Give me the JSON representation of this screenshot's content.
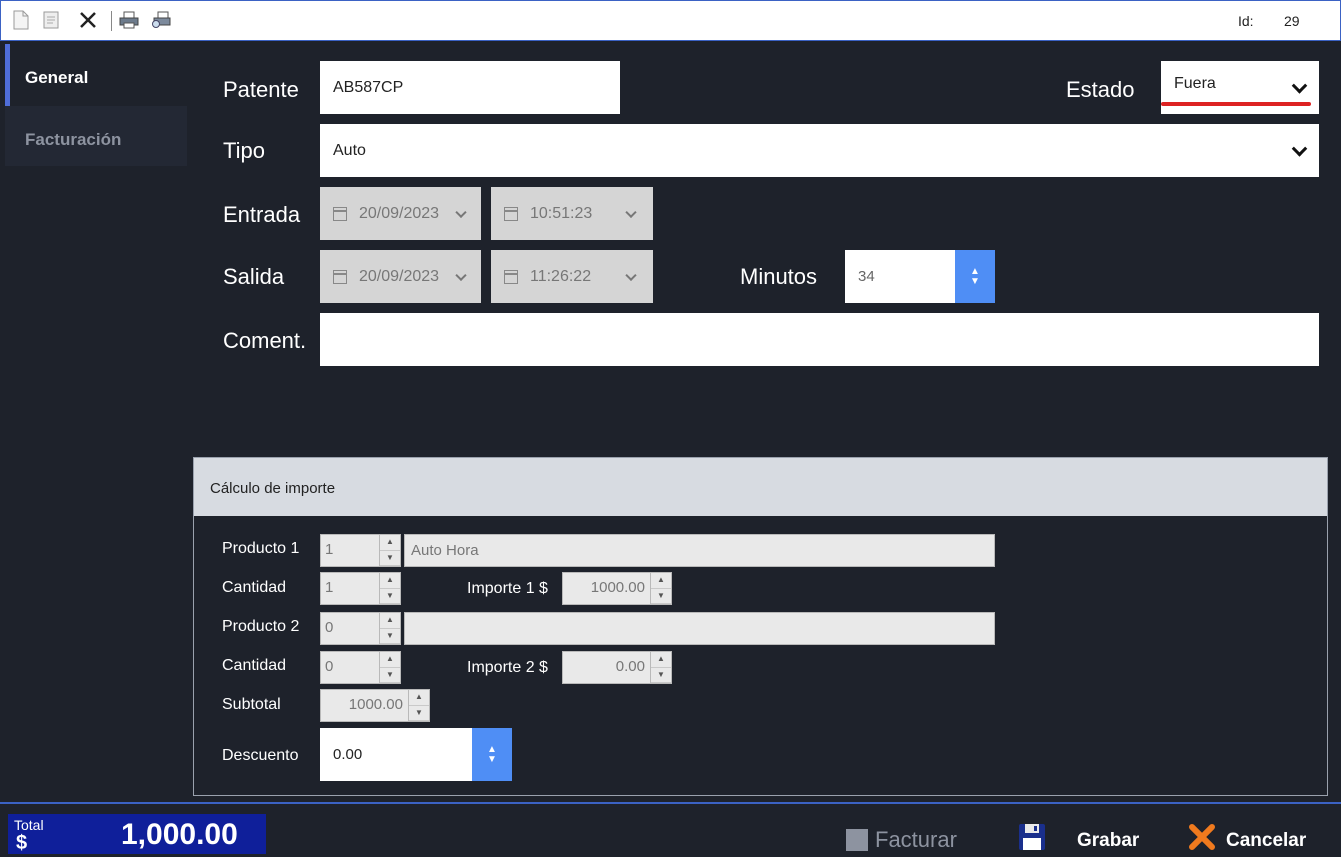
{
  "toolbar": {
    "id_label": "Id:",
    "id_value": "29",
    "icons": [
      "new-document-icon",
      "edit-document-icon",
      "delete-icon",
      "print-icon",
      "print-preview-icon"
    ]
  },
  "tabs": {
    "general": "General",
    "facturacion": "Facturación"
  },
  "form": {
    "patente_label": "Patente",
    "patente_value": "AB587CP",
    "estado_label": "Estado",
    "estado_value": "Fuera",
    "tipo_label": "Tipo",
    "tipo_value": "Auto",
    "entrada_label": "Entrada",
    "entrada_date": "20/09/2023",
    "entrada_time": "10:51:23",
    "salida_label": "Salida",
    "salida_date": "20/09/2023",
    "salida_time": "11:26:22",
    "minutos_label": "Minutos",
    "minutos_value": "34",
    "coment_label": "Coment.",
    "coment_value": ""
  },
  "calc": {
    "title": "Cálculo de importe",
    "producto1_label": "Producto 1",
    "producto1_code": "1",
    "producto1_name": "Auto Hora",
    "cantidad1_label": "Cantidad",
    "cantidad1_value": "1",
    "importe1_label": "Importe 1 $",
    "importe1_value": "1000.00",
    "producto2_label": "Producto 2",
    "producto2_code": "0",
    "producto2_name": "",
    "cantidad2_label": "Cantidad",
    "cantidad2_value": "0",
    "importe2_label": "Importe 2 $",
    "importe2_value": "0.00",
    "subtotal_label": "Subtotal",
    "subtotal_value": "1000.00",
    "descuento_label": "Descuento",
    "descuento_value": "0.00"
  },
  "footer": {
    "total_label": "Total",
    "total_currency": "$",
    "total_value": "1,000.00",
    "facturar_label": "Facturar",
    "grabar_label": "Grabar",
    "cancelar_label": "Cancelar"
  },
  "colors": {
    "background": "#1e222b",
    "accent": "#4f8ef5",
    "total_box": "#0f1f9a",
    "estado_underline": "#dd2222"
  }
}
